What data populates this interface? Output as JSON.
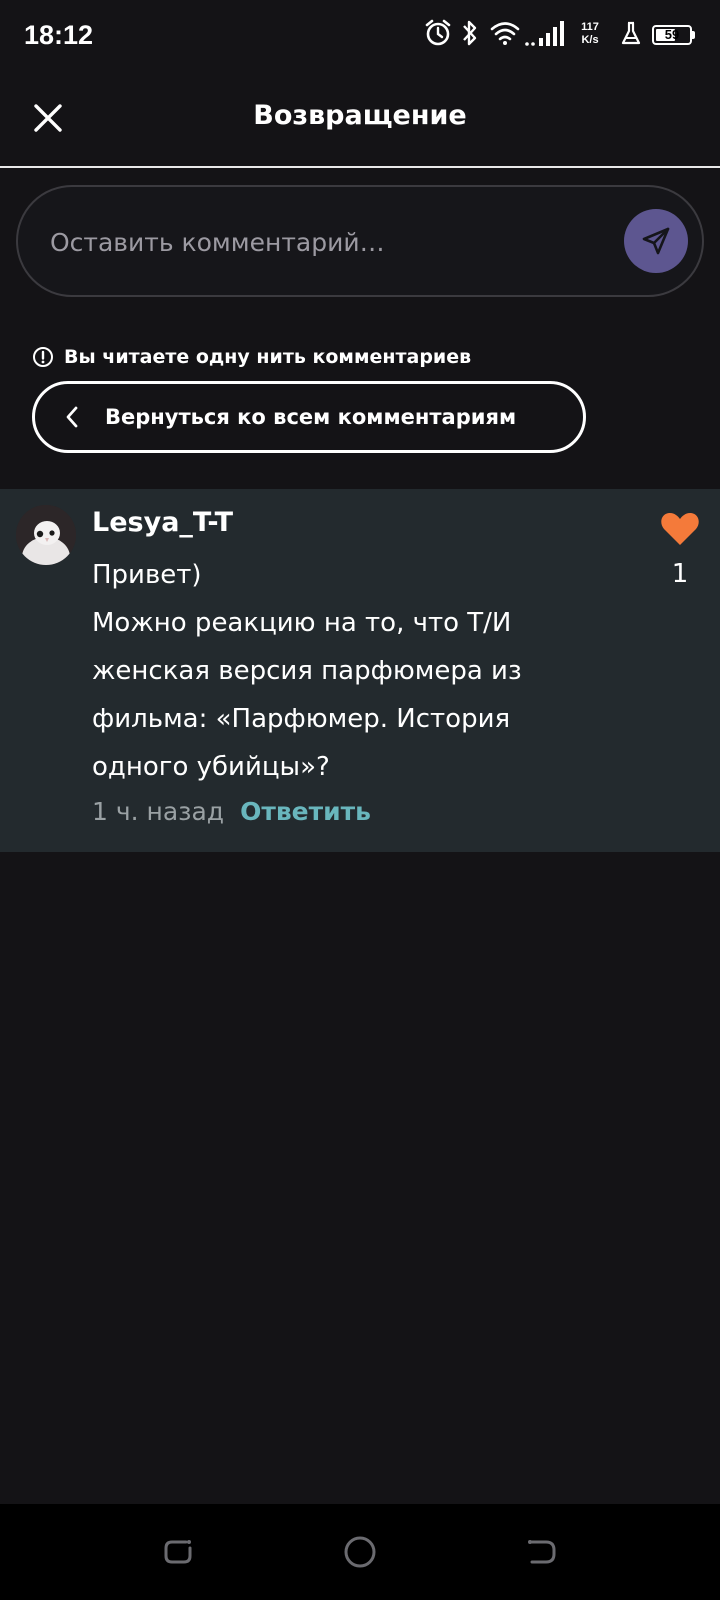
{
  "status_bar": {
    "time": "18:12",
    "net_speed_value": "117",
    "net_speed_unit": "K/s",
    "battery_level": "59",
    "icons": [
      "alarm-icon",
      "bluetooth-icon",
      "wifi-icon",
      "signal-icon",
      "flask-icon",
      "battery-icon"
    ]
  },
  "header": {
    "title": "Возвращение",
    "close_icon": "close-icon"
  },
  "comment_input": {
    "placeholder": "Оставить комментарий…",
    "send_icon": "send-icon",
    "send_color": "#5d5690"
  },
  "thread_notice": {
    "text": "Вы читаете одну нить комментариев",
    "icon": "info-icon"
  },
  "back_button": {
    "label": "Вернуться ко всем комментариям",
    "icon": "chevron-left-icon"
  },
  "comment": {
    "username": "Lesya_T-T",
    "lines": [
      "Привет)",
      "Можно реакцию на то, что Т/И",
      "женская версия парфюмера из",
      "фильма: «Парфюмер. История",
      "одного убийцы»?"
    ],
    "timestamp": "1 ч. назад",
    "reply_label": "Ответить",
    "likes": "1",
    "like_icon": "heart-icon",
    "like_color": "#f47a3a",
    "reply_color": "#69b6bd",
    "background": "#232a2e"
  },
  "nav_bar": {
    "icons": [
      "recent-apps-icon",
      "home-icon",
      "back-icon"
    ]
  }
}
